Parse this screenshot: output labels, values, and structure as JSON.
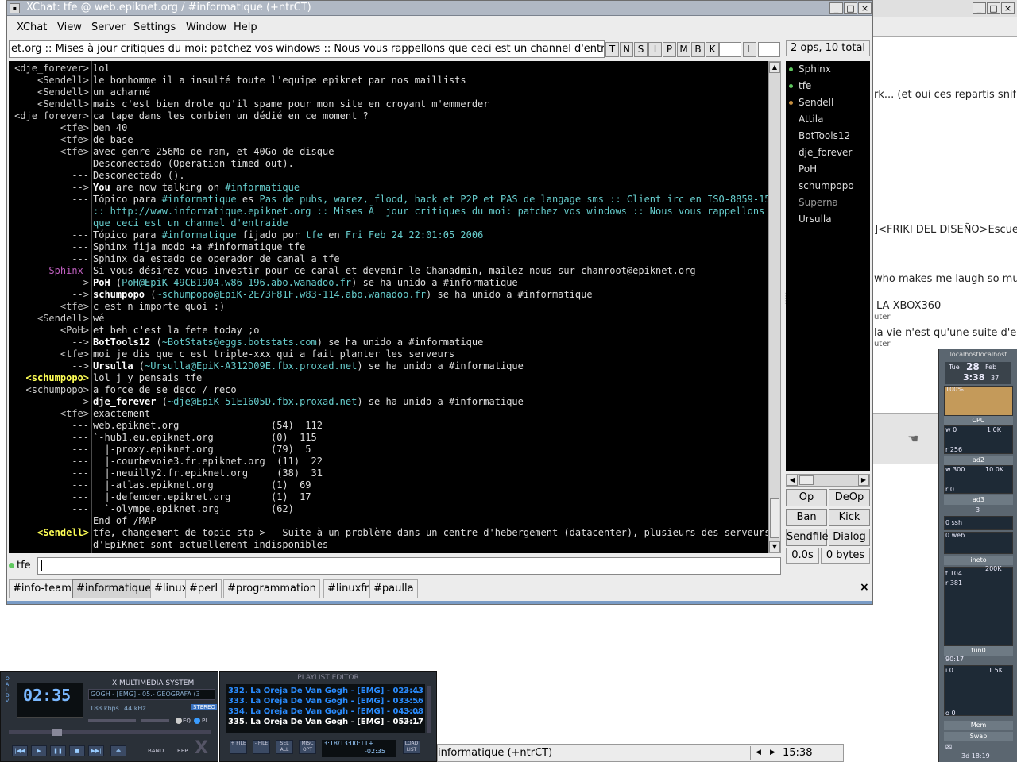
{
  "bgwin": {
    "frag1": "rk... (et oui ces repartis snif",
    "frag2": "]<FRIKI DEL DISEÑO>Escuela",
    "frag3": "who makes me laugh so muc",
    "frag4": "LA XBOX360",
    "frag5": "uter",
    "frag6": "la vie n'est qu'une suite d'ec",
    "frag7": "uter"
  },
  "window": {
    "title": "XChat: tfe @ web.epiknet.org / #informatique (+ntrCT)"
  },
  "menu": {
    "xchat": "XChat",
    "view": "View",
    "server": "Server",
    "settings": "Settings",
    "window": "Window",
    "help": "Help"
  },
  "topic": {
    "text": "et.org :: Mises à jour critiques du moi: patchez vos windows :: Nous vous rappellons que ceci est un channel d'entraide",
    "modes": [
      "T",
      "N",
      "S",
      "I",
      "P",
      "M",
      "B",
      "K"
    ],
    "limit_label": "L",
    "user_count": "2 ops, 10 total"
  },
  "chat": [
    {
      "nick": "<dje_forever>",
      "parts": [
        {
          "t": "lol"
        }
      ]
    },
    {
      "nick": "<Sendell>",
      "parts": [
        {
          "t": "le bonhomme il a insulté toute l'equipe epiknet par nos maillists"
        }
      ]
    },
    {
      "nick": "<Sendell>",
      "parts": [
        {
          "t": "un acharné"
        }
      ]
    },
    {
      "nick": "<Sendell>",
      "parts": [
        {
          "t": "mais c'est bien drole qu'il spame pour mon site en croyant m'emmerder"
        }
      ]
    },
    {
      "nick": "<dje_forever>",
      "parts": [
        {
          "t": "ca tape dans les combien un dédié en ce moment ?"
        }
      ]
    },
    {
      "nick": "<tfe>",
      "parts": [
        {
          "t": "ben 40"
        }
      ]
    },
    {
      "nick": "<tfe>",
      "parts": [
        {
          "t": "de base"
        }
      ]
    },
    {
      "nick": "<tfe>",
      "parts": [
        {
          "t": "avec genre 256Mo de ram, et 40Go de disque"
        }
      ]
    },
    {
      "nick": "---",
      "parts": [
        {
          "t": "Desconectado (Operation timed out)."
        }
      ]
    },
    {
      "nick": "---",
      "parts": [
        {
          "t": "Desconectado ()."
        }
      ]
    },
    {
      "nick": "-->",
      "parts": [
        {
          "t": "You",
          "c": "c-w"
        },
        {
          "t": " are now talking on "
        },
        {
          "t": "#informatique",
          "c": "c-cy"
        }
      ]
    },
    {
      "nick": "---",
      "parts": [
        {
          "t": "Tópico para "
        },
        {
          "t": "#informatique",
          "c": "c-cy"
        },
        {
          "t": " es "
        },
        {
          "t": "Pas de pubs, warez, flood, hack et P2P et PAS de langage sms :: Client irc en ISO-8859-15",
          "c": "c-cy"
        }
      ]
    },
    {
      "nick": "",
      "parts": [
        {
          "t": ":: http://www.informatique.epiknet.org :: Mises Ã  jour critiques du moi: patchez vos windows :: Nous vous rappellons",
          "c": "c-cy"
        }
      ]
    },
    {
      "nick": "",
      "parts": [
        {
          "t": "que ceci est un channel d'entraide",
          "c": "c-cy"
        }
      ]
    },
    {
      "nick": "---",
      "parts": [
        {
          "t": "Tópico para "
        },
        {
          "t": "#informatique",
          "c": "c-cy"
        },
        {
          "t": " fijado por "
        },
        {
          "t": "tfe",
          "c": "c-cy"
        },
        {
          "t": " en "
        },
        {
          "t": "Fri Feb 24 22:01:05 2006",
          "c": "c-cy"
        }
      ]
    },
    {
      "nick": "---",
      "parts": [
        {
          "t": "Sphinx fija modo +a #informatique tfe"
        }
      ]
    },
    {
      "nick": "---",
      "parts": [
        {
          "t": "Sphinx da estado de operador de canal a tfe"
        }
      ]
    },
    {
      "nick": "-Sphinx-",
      "nc": "c-p",
      "parts": [
        {
          "t": "Si vous désirez vous investir pour ce canal et devenir le Chanadmin, mailez nous sur chanroot@epiknet.org"
        }
      ]
    },
    {
      "nick": "-->",
      "parts": [
        {
          "t": "PoH",
          "c": "c-w"
        },
        {
          "t": " ("
        },
        {
          "t": "PoH@EpiK-49CB1904.w86-196.abo.wanadoo.fr",
          "c": "c-cy"
        },
        {
          "t": ") se ha unido a #informatique"
        }
      ]
    },
    {
      "nick": "-->",
      "parts": [
        {
          "t": "schumpopo",
          "c": "c-w"
        },
        {
          "t": " ("
        },
        {
          "t": "~schumpopo@EpiK-2E73F81F.w83-114.abo.wanadoo.fr",
          "c": "c-cy"
        },
        {
          "t": ") se ha unido a #informatique"
        }
      ]
    },
    {
      "nick": "<tfe>",
      "parts": [
        {
          "t": "c est n importe quoi :)"
        }
      ]
    },
    {
      "nick": "<Sendell>",
      "parts": [
        {
          "t": "wé"
        }
      ]
    },
    {
      "nick": "<PoH>",
      "parts": [
        {
          "t": "et beh c'est la fete today ;o"
        }
      ]
    },
    {
      "nick": "-->",
      "parts": [
        {
          "t": "BotTools12",
          "c": "c-w"
        },
        {
          "t": " ("
        },
        {
          "t": "~BotStats@eggs.botstats.com",
          "c": "c-cy"
        },
        {
          "t": ") se ha unido a #informatique"
        }
      ]
    },
    {
      "nick": "<tfe>",
      "parts": [
        {
          "t": "moi je dis que c est triple-xxx qui a fait planter les serveurs"
        }
      ]
    },
    {
      "nick": "-->",
      "parts": [
        {
          "t": "Ursulla",
          "c": "c-w"
        },
        {
          "t": " ("
        },
        {
          "t": "~Ursulla@EpiK-A312D09E.fbx.proxad.net",
          "c": "c-cy"
        },
        {
          "t": ") se ha unido a #informatique"
        }
      ]
    },
    {
      "nick": "<schumpopo>",
      "nc": "c-y",
      "parts": [
        {
          "t": "lol j y pensais tfe"
        }
      ]
    },
    {
      "nick": "<schumpopo>",
      "parts": [
        {
          "t": "a force de se deco / reco"
        }
      ]
    },
    {
      "nick": "-->",
      "parts": [
        {
          "t": "dje_forever",
          "c": "c-w"
        },
        {
          "t": " ("
        },
        {
          "t": "~dje@EpiK-51E1605D.fbx.proxad.net",
          "c": "c-cy"
        },
        {
          "t": ") se ha unido a #informatique"
        }
      ]
    },
    {
      "nick": "<tfe>",
      "parts": [
        {
          "t": "exactement"
        }
      ]
    },
    {
      "nick": "---",
      "parts": [
        {
          "t": "web.epiknet.org                (54)  112"
        }
      ]
    },
    {
      "nick": "---",
      "parts": [
        {
          "t": "`-hub1.eu.epiknet.org          (0)  115"
        }
      ]
    },
    {
      "nick": "---",
      "parts": [
        {
          "t": "  |-proxy.epiknet.org          (79)  5"
        }
      ]
    },
    {
      "nick": "---",
      "parts": [
        {
          "t": "  |-courbevoie3.fr.epiknet.org  (11)  22"
        }
      ]
    },
    {
      "nick": "---",
      "parts": [
        {
          "t": "  |-neuilly2.fr.epiknet.org     (38)  31"
        }
      ]
    },
    {
      "nick": "---",
      "parts": [
        {
          "t": "  |-atlas.epiknet.org          (1)  69"
        }
      ]
    },
    {
      "nick": "---",
      "parts": [
        {
          "t": "  |-defender.epiknet.org       (1)  17"
        }
      ]
    },
    {
      "nick": "---",
      "parts": [
        {
          "t": "  `-olympe.epiknet.org         (62)"
        }
      ]
    },
    {
      "nick": "---",
      "parts": [
        {
          "t": "End of /MAP"
        }
      ]
    },
    {
      "nick": "<Sendell>",
      "nc": "c-y",
      "parts": [
        {
          "t": "tfe, changement de topic stp >   Suite à un problème dans un centre d'hebergement (datacenter), plusieurs des serveurs"
        }
      ]
    },
    {
      "nick": "",
      "parts": [
        {
          "t": "d'EpiKnet sont actuellement indisponibles"
        }
      ]
    }
  ],
  "users": [
    {
      "name": "Sphinx",
      "dot": "#5fc85f"
    },
    {
      "name": "tfe",
      "dot": "#5fc85f"
    },
    {
      "name": "Sendell",
      "dot": "#c89040"
    },
    {
      "name": "Attila",
      "dot": ""
    },
    {
      "name": "BotTools12",
      "dot": ""
    },
    {
      "name": "dje_forever",
      "dot": ""
    },
    {
      "name": "PoH",
      "dot": ""
    },
    {
      "name": "schumpopo",
      "dot": ""
    },
    {
      "name": "Superna",
      "dot": "",
      "dim": true
    },
    {
      "name": "Ursulla",
      "dot": ""
    }
  ],
  "user_buttons": {
    "op": "Op",
    "deop": "DeOp",
    "ban": "Ban",
    "kick": "Kick",
    "sendfile": "Sendfile",
    "dialog": "Dialog",
    "lag": "0.0s",
    "bytes": "0 bytes"
  },
  "input": {
    "nick": "tfe",
    "value": ""
  },
  "tabs": [
    "#info-team",
    "#informatique",
    "#linux",
    "#perl",
    "#programmation",
    "#linuxfr",
    "#paulla"
  ],
  "active_tab": "#informatique",
  "tab_close": "×",
  "xmms": {
    "title": "X MULTIMEDIA SYSTEM",
    "time": "02:35",
    "scroll": "GOGH - [EMG] - 05.- GEOGRAFA (3",
    "kbps": "188 kbps",
    "khz": "44 kHz",
    "stereo": "STEREO",
    "eq": "EQ",
    "pl": "PL",
    "band": "BAND",
    "rep": "REP",
    "logo": "X"
  },
  "playlist": {
    "header": "PLAYLIST EDITOR",
    "items": [
      {
        "label": "332. La Oreja De Van Gogh - [EMG] - 02.-...",
        "time": "3:43"
      },
      {
        "label": "333. La Oreja De Van Gogh - [EMG] - 03.-...",
        "time": "3:56"
      },
      {
        "label": "334. La Oreja De Van Gogh - [EMG] - 04.-...",
        "time": "3:08"
      },
      {
        "label": "335. La Oreja De Van Gogh - [EMG] - 05.-...",
        "time": "3:17"
      }
    ],
    "buttons": [
      "+ FILE",
      "- FILE",
      "SEL ALL",
      "MISC OPT"
    ],
    "load": "LOAD LIST",
    "timer": "3:18/13:00:11+",
    "remain": "-02:35"
  },
  "taskbar": {
    "text": "informatique (+ntrCT)",
    "clock": "15:38"
  },
  "gkrellm": {
    "host": "localhostlocalhost",
    "day": "Tue",
    "date": "28",
    "month": "Feb",
    "time": "3:38",
    "sec": "37",
    "cpu_pct": "100%",
    "cpu": "CPU",
    "w0": "w 0",
    "k1": "1.0K",
    "r256": "r 256",
    "ad2": "ad2",
    "w300": "w 300",
    "k10": "10.0K",
    "r0": "r 0",
    "ad3": "ad3",
    "three": "3",
    "ssh": "0 ssh",
    "web": "0 web",
    "ineto": "ineto",
    "t104": "t 104",
    "k200": "200K",
    "r381": "r 381",
    "tun0": "tun0",
    "tun_time": "90:17",
    "i0": "i 0",
    "k15": "1.5K",
    "o0": "o 0",
    "mem": "Mem",
    "swap": "Swap",
    "uptime": "3d 18:19"
  }
}
